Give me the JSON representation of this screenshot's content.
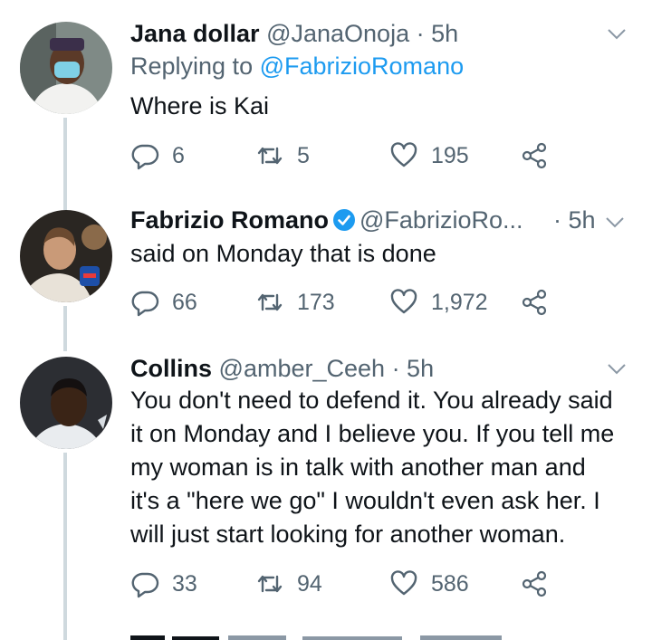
{
  "tweets": [
    {
      "name": "Jana dollar",
      "handle": "@JanaOnoja",
      "time": "· 5h",
      "replying_label": "Replying to",
      "replying_to": "@FabrizioRomano",
      "text": "Where is Kai",
      "replies": "6",
      "retweets": "5",
      "likes": "195"
    },
    {
      "name": "Fabrizio Romano",
      "handle": "@FabrizioRo...",
      "time": "· 5h",
      "text": "said on Monday that is done",
      "replies": "66",
      "retweets": "173",
      "likes": "1,972"
    },
    {
      "name": "Collins",
      "handle": "@amber_Ceeh",
      "time": "· 5h",
      "text": "You don't need to defend it. You already said\nit on Monday and I believe you. If you tell me\nmy woman is in talk with another man and\nit's a \"here we go\" I wouldn't even ask her. I\nwill just start looking for another woman.",
      "replies": "33",
      "retweets": "94",
      "likes": "586"
    }
  ],
  "colors": {
    "text": "#0f1419",
    "secondary": "#536471",
    "accent": "#1d9bf0",
    "thread_line": "#cfd9de"
  }
}
